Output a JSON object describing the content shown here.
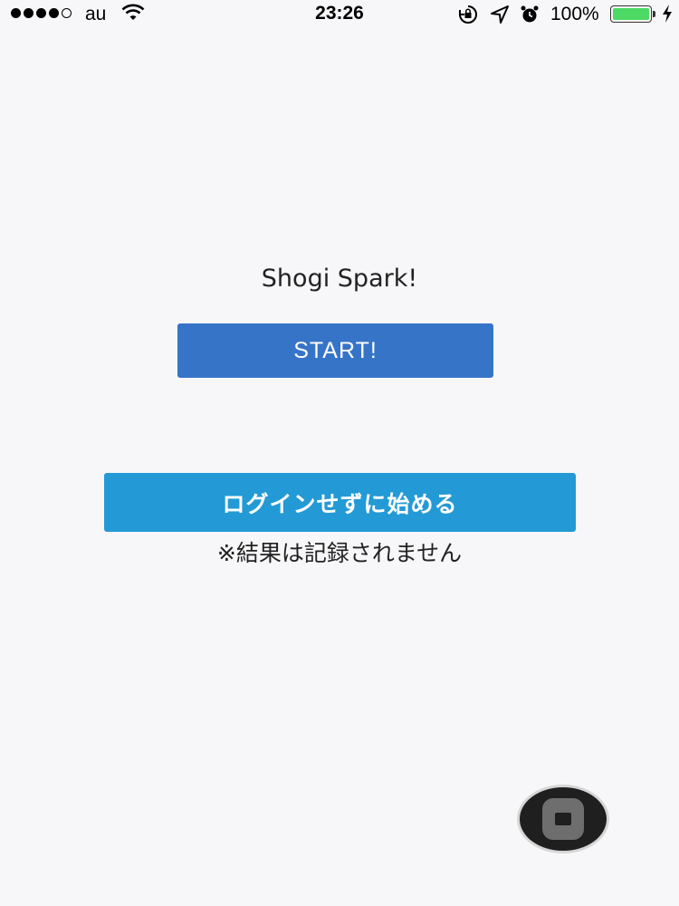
{
  "status_bar": {
    "carrier": "au",
    "time": "23:26",
    "battery_percent": "100%",
    "battery_level": 1.0,
    "signal_bars_filled": 4,
    "signal_bars_total": 5,
    "icons": [
      "wifi-icon",
      "rotation-lock-icon",
      "location-arrow-icon",
      "alarm-icon",
      "battery-icon",
      "charging-bolt-icon"
    ]
  },
  "main": {
    "title": "Shogi Spark!",
    "start_label": "START!",
    "guest_label": "ログインせずに始める",
    "note": "※結果は記録されません"
  },
  "colors": {
    "start_button": "#3674c8",
    "guest_button": "#239ad5",
    "background": "#f7f7f9",
    "battery_fill": "#4cd964"
  }
}
